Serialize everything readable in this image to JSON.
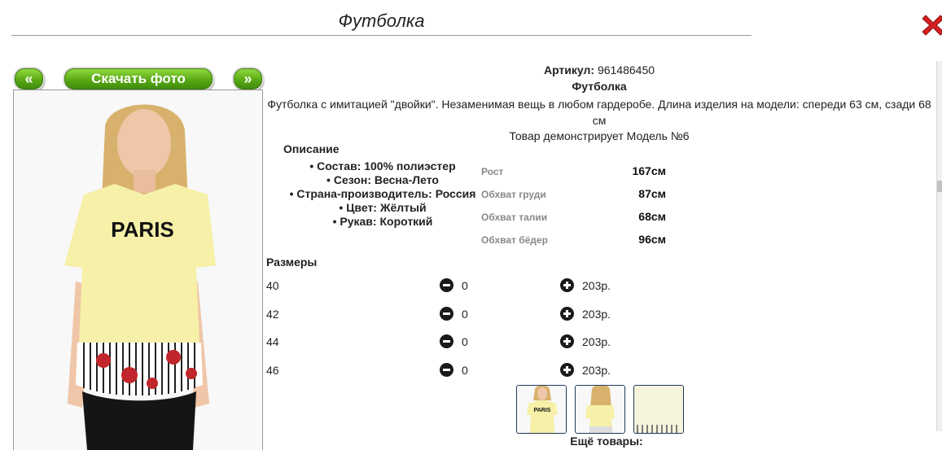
{
  "window": {
    "title": "Футболка"
  },
  "photo_nav": {
    "prev_label": "«",
    "download_label": "Скачать фото",
    "next_label": "»"
  },
  "product": {
    "article_label": "Артикул:",
    "article_value": "961486450",
    "name": "Футболка",
    "description": "Футболка с имитацией \"двойки\". Незаменимая вещь в любом гардеробе. Длина изделия на модели: спереди 63 см, сзади 68 см",
    "model_note": "Товар демонстрирует Модель №6"
  },
  "photo_text": "PARIS",
  "details": {
    "title": "Описание",
    "items": [
      "Состав: 100% полиэстер",
      "Сезон: Весна-Лето",
      "Страна-производитель: Россия",
      "Цвет: Жёлтый",
      "Рукав: Короткий"
    ]
  },
  "measurements": [
    {
      "label": "Рост",
      "value": "167см"
    },
    {
      "label": "Обхват груди",
      "value": "87см"
    },
    {
      "label": "Обхват талии",
      "value": "68см"
    },
    {
      "label": "Обхват бёдер",
      "value": "96см"
    }
  ],
  "sizes": {
    "title": "Размеры",
    "rows": [
      {
        "size": "40",
        "qty": "0",
        "price": "203р."
      },
      {
        "size": "42",
        "qty": "0",
        "price": "203р."
      },
      {
        "size": "44",
        "qty": "0",
        "price": "203р."
      },
      {
        "size": "46",
        "qty": "0",
        "price": "203р."
      }
    ]
  },
  "thumbnails_text": "PARIS",
  "more_label": "Ещё товары:",
  "colors": {
    "accent_green": "#5aa915",
    "close_red": "#d61f1f",
    "shirt_yellow": "#f6f0a8"
  }
}
